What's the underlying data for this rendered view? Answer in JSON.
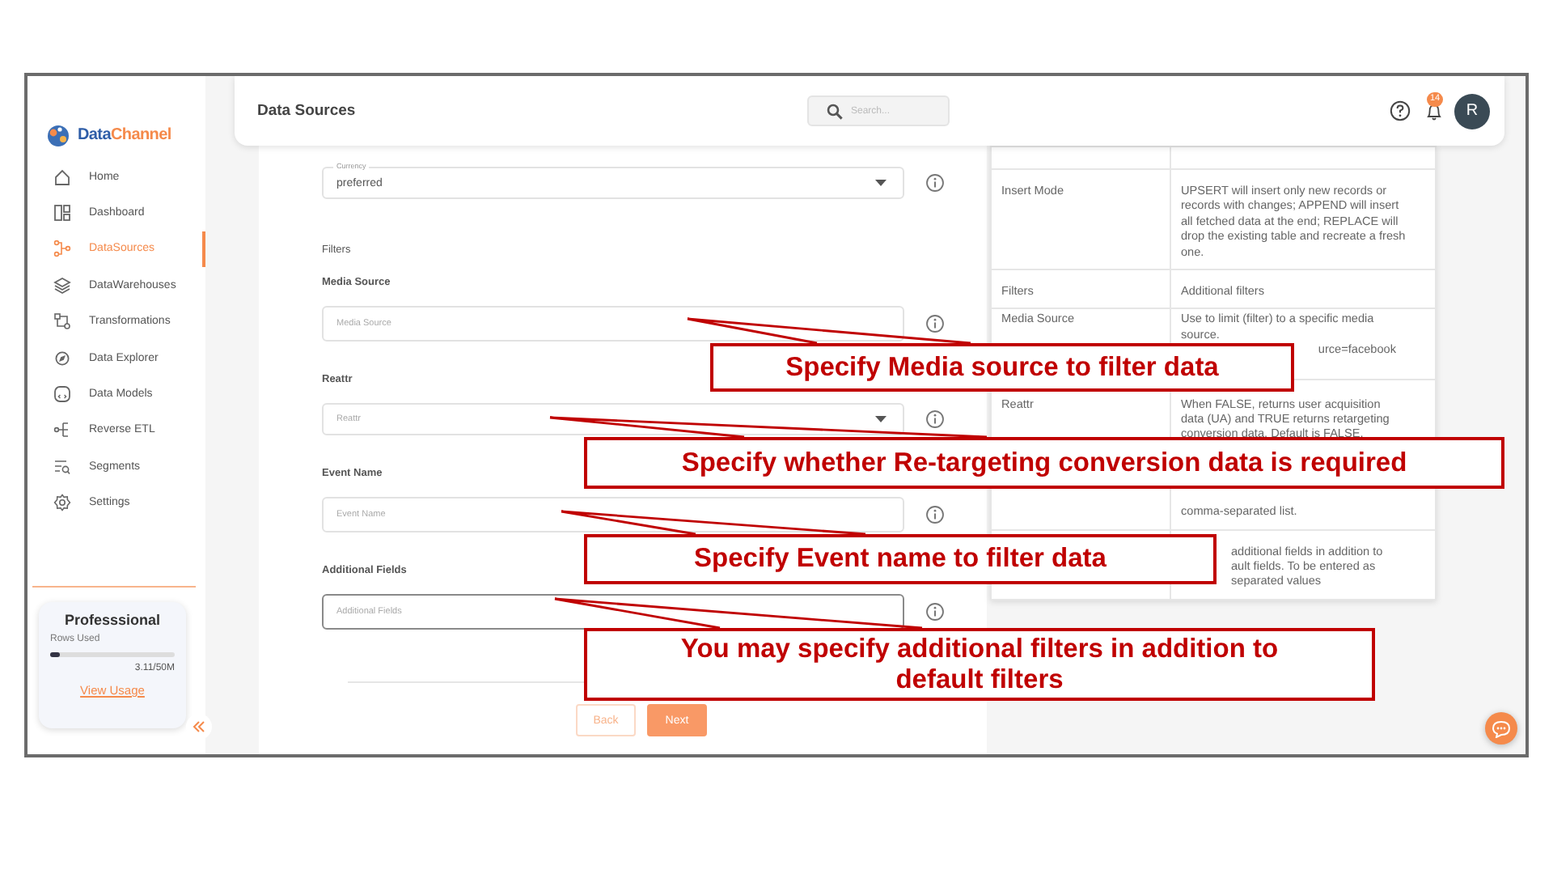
{
  "sidebar": {
    "logo": {
      "text_1": "Data",
      "text_2": "Channel"
    },
    "items": [
      {
        "label": "Home",
        "selected": false
      },
      {
        "label": "Dashboard",
        "selected": false
      },
      {
        "label": "DataSources",
        "selected": true
      },
      {
        "label": "DataWarehouses",
        "selected": false
      },
      {
        "label": "Transformations",
        "selected": false
      },
      {
        "label": "Data Explorer",
        "selected": false
      },
      {
        "label": "Data Models",
        "selected": false
      },
      {
        "label": "Reverse ETL",
        "selected": false
      },
      {
        "label": "Segments",
        "selected": false
      },
      {
        "label": "Settings",
        "selected": false
      }
    ],
    "plan": {
      "title": "Professsional",
      "rows_label": "Rows Used",
      "level": 0.08,
      "reading": "3.11/50M",
      "link": "View Usage"
    }
  },
  "header": {
    "title": "Data Sources",
    "search": {
      "placeholder": "Search..."
    },
    "notification_count": "14",
    "avatar": "R"
  },
  "form": {
    "items": [
      {
        "kind": "select",
        "floating_label": "Currency",
        "value": "preferred",
        "focused": false
      },
      {
        "kind": "heading",
        "text": "Filters"
      },
      {
        "kind": "input",
        "label": "Media Source",
        "placeholder": "Media Source",
        "focused": false
      },
      {
        "kind": "select",
        "label": "Reattr",
        "placeholder": "Reattr",
        "focused": false
      },
      {
        "kind": "input",
        "label": "Event Name",
        "placeholder": "Event Name",
        "focused": false
      },
      {
        "kind": "input",
        "label": "Additional Fields",
        "placeholder": "Additional Fields",
        "focused": true
      }
    ],
    "buttons": [
      {
        "label": "Back",
        "kind": "secondary"
      },
      {
        "label": "Next",
        "kind": "primary"
      }
    ]
  },
  "table": {
    "rows": [
      {
        "parts": []
      },
      {
        "name": "Insert Mode",
        "parts": [
          {
            "kind": "full",
            "text": "UPSERT will insert only new records or records with changes; APPEND will insert all fetched data at the end; REPLACE will drop the existing table and recreate a fresh one."
          }
        ]
      },
      {
        "name": "Filters",
        "parts": [
          {
            "kind": "full",
            "text": "Additional filters"
          }
        ]
      },
      {
        "name": "Media Source",
        "parts": [
          {
            "kind": "full",
            "text": "Use to limit (filter) to a specific media source."
          },
          {
            "kind": "tail",
            "text": "urce=facebook"
          }
        ]
      },
      {
        "name": "Reattr",
        "parts": [
          {
            "kind": "full",
            "text": "When FALSE, returns user acquisition data (UA) and TRUE returns retargeting conversion data. Default is FALSE."
          }
        ]
      },
      {
        "parts": [
          {
            "kind": "full",
            "text": "comma-separated list."
          }
        ]
      },
      {
        "parts": [
          {
            "kind": "cut",
            "text": "additional fields in addition to"
          },
          {
            "kind": "cut",
            "text": "ault fields. To be entered as"
          },
          {
            "kind": "cut",
            "text": "separated values"
          }
        ]
      }
    ]
  },
  "callouts": [
    {
      "text": "Specify Media source to filter data"
    },
    {
      "text": "Specify whether Re-targeting conversion data is required"
    },
    {
      "text": "Specify Event name to filter data"
    },
    {
      "text": "You may specify additional filters in addition to default filters"
    }
  ]
}
